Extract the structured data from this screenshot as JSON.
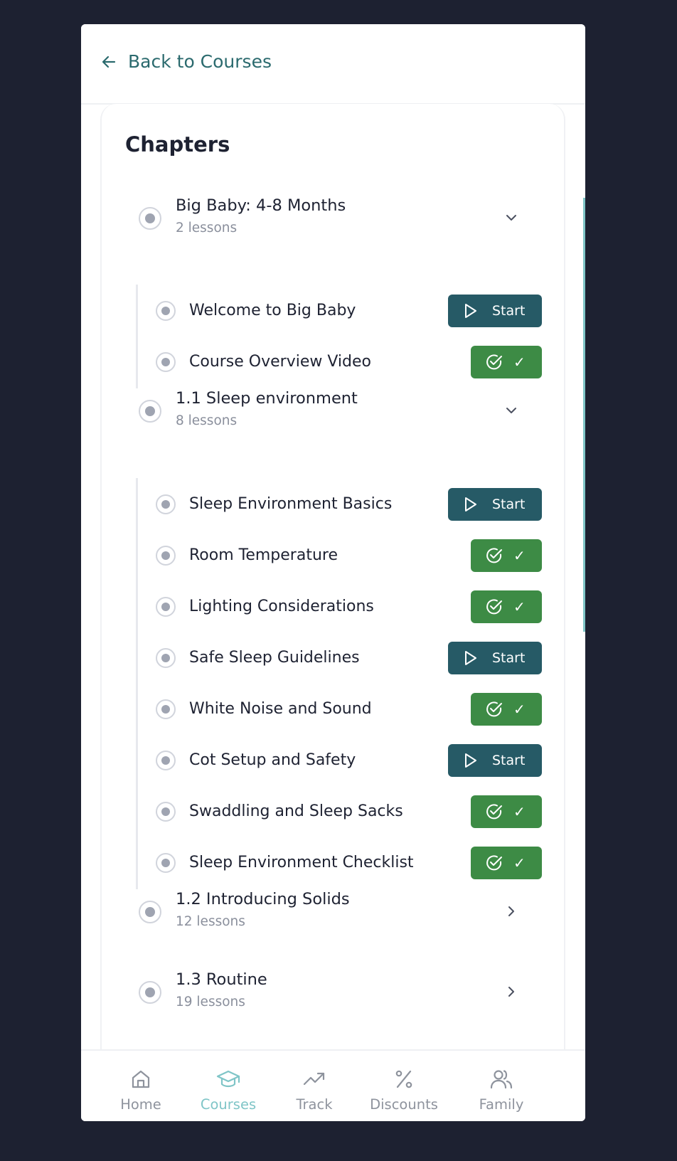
{
  "header": {
    "back_label": "Back to Courses"
  },
  "card": {
    "title": "Chapters"
  },
  "chapters": [
    {
      "title": "Big Baby: 4-8 Months",
      "sub": "2 lessons",
      "expanded": true,
      "lessons": [
        {
          "title": "Welcome to Big Baby",
          "status": "start",
          "action": "Start"
        },
        {
          "title": "Course Overview Video",
          "status": "done",
          "action": "✓"
        }
      ]
    },
    {
      "title": "1.1 Sleep environment",
      "sub": "8 lessons",
      "expanded": true,
      "lessons": [
        {
          "title": "Sleep Environment Basics",
          "status": "start",
          "action": "Start"
        },
        {
          "title": "Room Temperature",
          "status": "done",
          "action": "✓"
        },
        {
          "title": "Lighting Considerations",
          "status": "done",
          "action": "✓"
        },
        {
          "title": "Safe Sleep Guidelines",
          "status": "start",
          "action": "Start"
        },
        {
          "title": "White Noise and Sound",
          "status": "done",
          "action": "✓"
        },
        {
          "title": "Cot Setup and Safety",
          "status": "start",
          "action": "Start"
        },
        {
          "title": "Swaddling and Sleep Sacks",
          "status": "done",
          "action": "✓"
        },
        {
          "title": "Sleep Environment Checklist",
          "status": "done",
          "action": "✓"
        }
      ]
    },
    {
      "title": "1.2 Introducing Solids",
      "sub": "12 lessons",
      "expanded": false,
      "lessons": []
    },
    {
      "title": "1.3 Routine",
      "sub": "19 lessons",
      "expanded": false,
      "lessons": []
    }
  ],
  "nav": {
    "home": "Home",
    "courses": "Courses",
    "track": "Track",
    "discounts": "Discounts",
    "family": "Family",
    "active": "courses"
  },
  "colors": {
    "background": "#1d2131",
    "accent": "#2b6a6e",
    "start_button": "#265a66",
    "done_button": "#3d8b45",
    "nav_active": "#7fc5c7"
  }
}
